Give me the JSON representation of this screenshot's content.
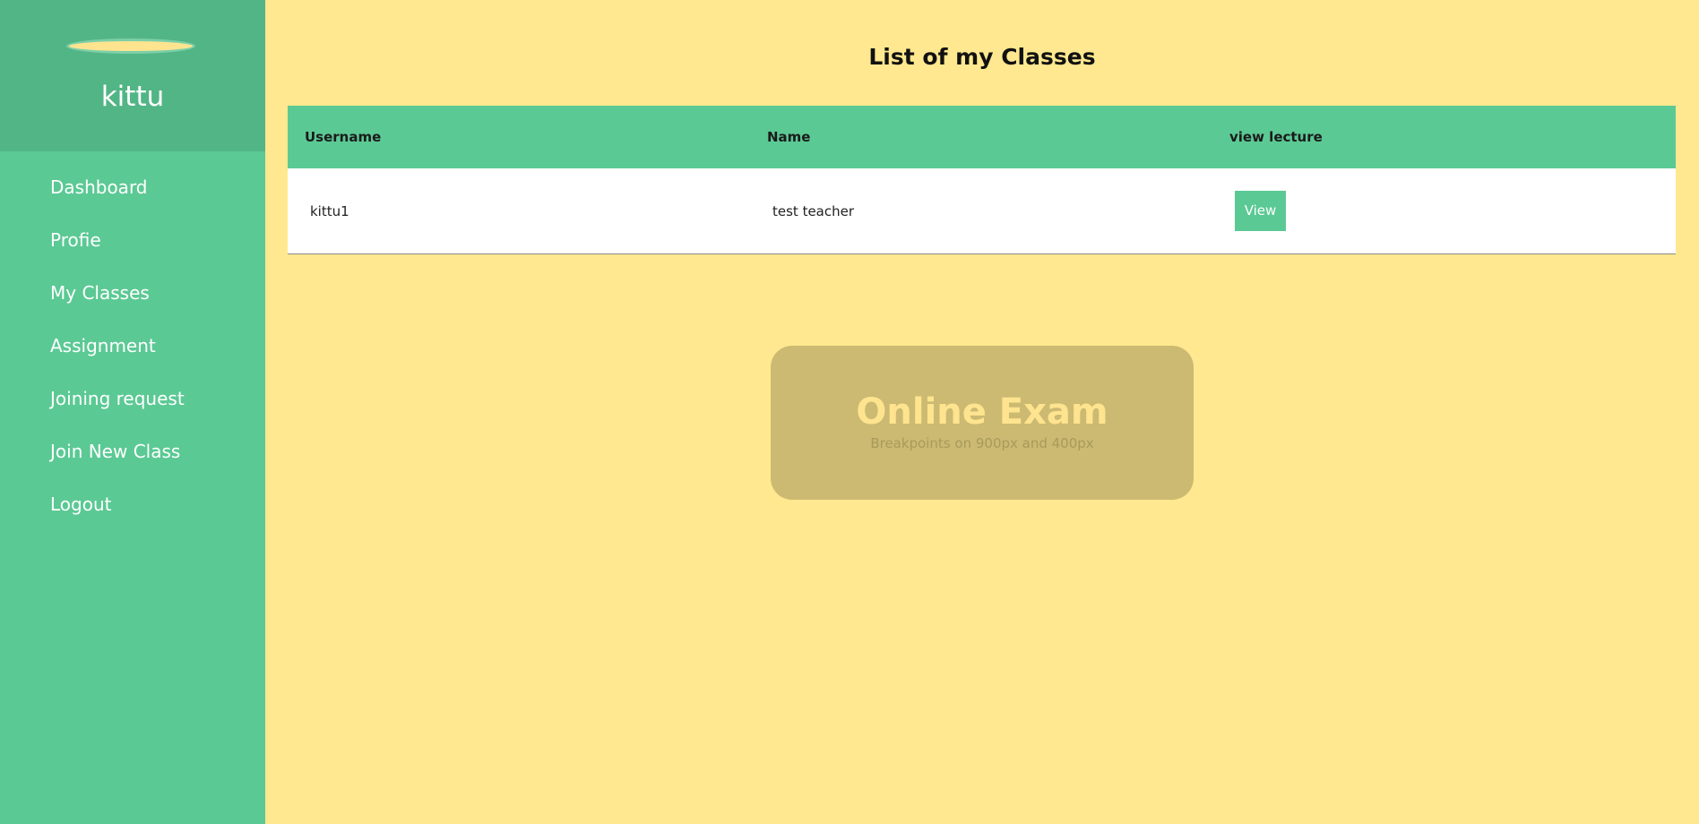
{
  "sidebar": {
    "username": "kittu",
    "items": [
      {
        "label": "Dashboard"
      },
      {
        "label": "Profie"
      },
      {
        "label": "My Classes"
      },
      {
        "label": "Assignment"
      },
      {
        "label": "Joining request"
      },
      {
        "label": "Join New Class"
      },
      {
        "label": "Logout"
      }
    ]
  },
  "main": {
    "title": "List of my Classes",
    "table": {
      "headers": [
        "Username",
        "Name",
        "view lecture"
      ],
      "rows": [
        {
          "username": "kittu1",
          "name": "test teacher",
          "action_label": "View"
        }
      ]
    },
    "banner": {
      "title": "Online Exam",
      "subtitle": "Breakpoints on 900px and 400px"
    }
  },
  "colors": {
    "sidebar": "#5bc994",
    "sidebar_header": "#52b585",
    "main_background": "#ffe88f",
    "banner": "#ccba72",
    "banner_title": "#ffe48f"
  }
}
